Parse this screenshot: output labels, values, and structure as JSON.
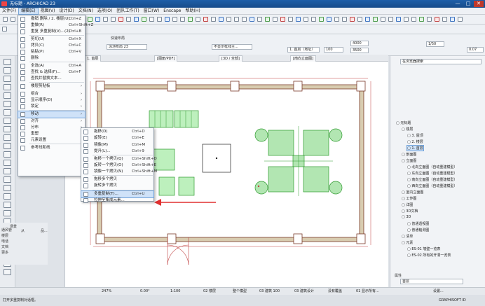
{
  "app": {
    "title": "无标题 - ARCHICAD 23",
    "window_buttons": [
      "—",
      "□",
      "✕"
    ]
  },
  "menubar": {
    "items": [
      "文件(F)",
      "编辑(E)",
      "视图(V)",
      "设计(D)",
      "文档(N)",
      "选项(O)",
      "团队工作(T)",
      "窗口(W)",
      "Enscape",
      "帮助(H)"
    ],
    "active_index": 1
  },
  "toolbar": {
    "quick_layouts": "快速布局",
    "layer_label": "泳池布局 23",
    "struct_label": "不显示框线主...",
    "floor_label": "1. 首层（地址）",
    "story_value": "100",
    "elev_a": "4000",
    "elev_b": "3500",
    "scale": "1/50",
    "dim": "0.07",
    "zoom_field": "3500",
    "view_buttons": [
      "2D",
      "3D"
    ]
  },
  "tabs": [
    {
      "label": "1. 首层"
    },
    {
      "label": "[图册/PDF]"
    },
    {
      "label": "[3D / 全部]"
    },
    {
      "label": "[南向立面图]"
    }
  ],
  "edit_menu": {
    "items": [
      {
        "label": "撤销 删除 / 2. 楼层(U)",
        "shortcut": "Ctrl+Z"
      },
      {
        "label": "重做(R)",
        "shortcut": "Ctrl+Shift+Z"
      },
      {
        "label": "重复 多重复制(V)...(2)",
        "shortcut": "Ctrl+B"
      },
      {
        "label": "剪切(U)",
        "shortcut": "Ctrl+X"
      },
      {
        "label": "拷贝(C)",
        "shortcut": "Ctrl+C"
      },
      {
        "label": "粘贴(P)",
        "shortcut": "Ctrl+V"
      },
      {
        "label": "删除",
        "shortcut": ""
      },
      {
        "label": "全选(A)",
        "shortcut": "Ctrl+A"
      },
      {
        "label": "查找 & 选择(F)...",
        "shortcut": "Ctrl+F"
      },
      {
        "label": "查找并替换文本...",
        "shortcut": ""
      },
      {
        "label": "楼层剪贴板",
        "shortcut": ""
      },
      {
        "label": "组合",
        "shortcut": ""
      },
      {
        "label": "显示顺序(D)",
        "shortcut": ""
      },
      {
        "label": "锁定",
        "shortcut": ""
      },
      {
        "label": "移动",
        "shortcut": ""
      },
      {
        "label": "对齐",
        "shortcut": ""
      },
      {
        "label": "分布",
        "shortcut": ""
      },
      {
        "label": "重塑",
        "shortcut": ""
      },
      {
        "label": "元素设置",
        "shortcut": ""
      },
      {
        "label": "参考线和线",
        "shortcut": ""
      }
    ],
    "highlighted_index": 14
  },
  "move_submenu": {
    "items": [
      {
        "label": "拖移(D)",
        "shortcut": "Ctrl+D"
      },
      {
        "label": "旋转(E)",
        "shortcut": "Ctrl+E"
      },
      {
        "label": "镜像(M)",
        "shortcut": "Ctrl+M"
      },
      {
        "label": "提升(L)...",
        "shortcut": "Ctrl+9"
      },
      {
        "label": "拖移一个拷贝(Q)",
        "shortcut": "Ctrl+Shift+D"
      },
      {
        "label": "旋转一个拷贝(O)",
        "shortcut": "Ctrl+Shift+E"
      },
      {
        "label": "镜像一个拷贝(N)",
        "shortcut": "Ctrl+Shift+M"
      },
      {
        "label": "拖移多个拷贝",
        "shortcut": ""
      },
      {
        "label": "旋转多个拷贝",
        "shortcut": ""
      },
      {
        "label": "多重复制(T)...",
        "shortcut": "Ctrl+U"
      },
      {
        "label": "拉伸至集成元素...",
        "shortcut": ""
      }
    ],
    "highlighted_index": 9
  },
  "left_info": {
    "layer": "场景",
    "rows": [
      "通风管",
      "楼层",
      "电话",
      "文档",
      "更多"
    ],
    "from_label": "从",
    "value": "品...",
    "extra": "对"
  },
  "navigator": {
    "search_placeholder": "在浏览器搜索",
    "items": [
      {
        "label": "无标题",
        "level": 0
      },
      {
        "label": "楼层",
        "level": 1
      },
      {
        "label": "3. 屋顶",
        "level": 2
      },
      {
        "label": "2. 楼层",
        "level": 2
      },
      {
        "label": "1. 首层",
        "level": 2,
        "selected": true
      },
      {
        "label": "剖面图",
        "level": 1
      },
      {
        "label": "立面图",
        "level": 1
      },
      {
        "label": "北向立面图（自动重建模型）",
        "level": 2
      },
      {
        "label": "东向立面图（自动重建模型）",
        "level": 2
      },
      {
        "label": "南向立面图（自动重建模型）",
        "level": 2
      },
      {
        "label": "西向立面图（自动重建模型）",
        "level": 2
      },
      {
        "label": "室内立面图",
        "level": 1
      },
      {
        "label": "工作图",
        "level": 1
      },
      {
        "label": "详图",
        "level": 1
      },
      {
        "label": "3D文档",
        "level": 1
      },
      {
        "label": "3D",
        "level": 1
      },
      {
        "label": "普通透视图",
        "level": 2
      },
      {
        "label": "普通轴测图",
        "level": 2
      },
      {
        "label": "清单",
        "level": 1
      },
      {
        "label": "元素",
        "level": 1
      },
      {
        "label": "ES-01 墙壁一览表",
        "level": 2
      },
      {
        "label": "ES-02 所有的开洞一览表",
        "level": 2
      }
    ],
    "properties_label": "属性",
    "prop_value": "首层",
    "settings_button": "设置..."
  },
  "statusbar": {
    "zoom": "247%",
    "angle": "0.00°",
    "scale": "1:100",
    "items": [
      "02 楼层",
      "整个模型",
      "03 建筑 100",
      "03 建筑设计",
      "没有覆盖",
      "01 显示所有..."
    ]
  },
  "hint": "打开多重复制对话框。",
  "graphisoft": "GRAPHISOFT ID",
  "colors": {
    "accent": "#2b6fc2",
    "wall": "#d8ccb0",
    "furniture": "#59c959",
    "arrow": "#e03030"
  }
}
